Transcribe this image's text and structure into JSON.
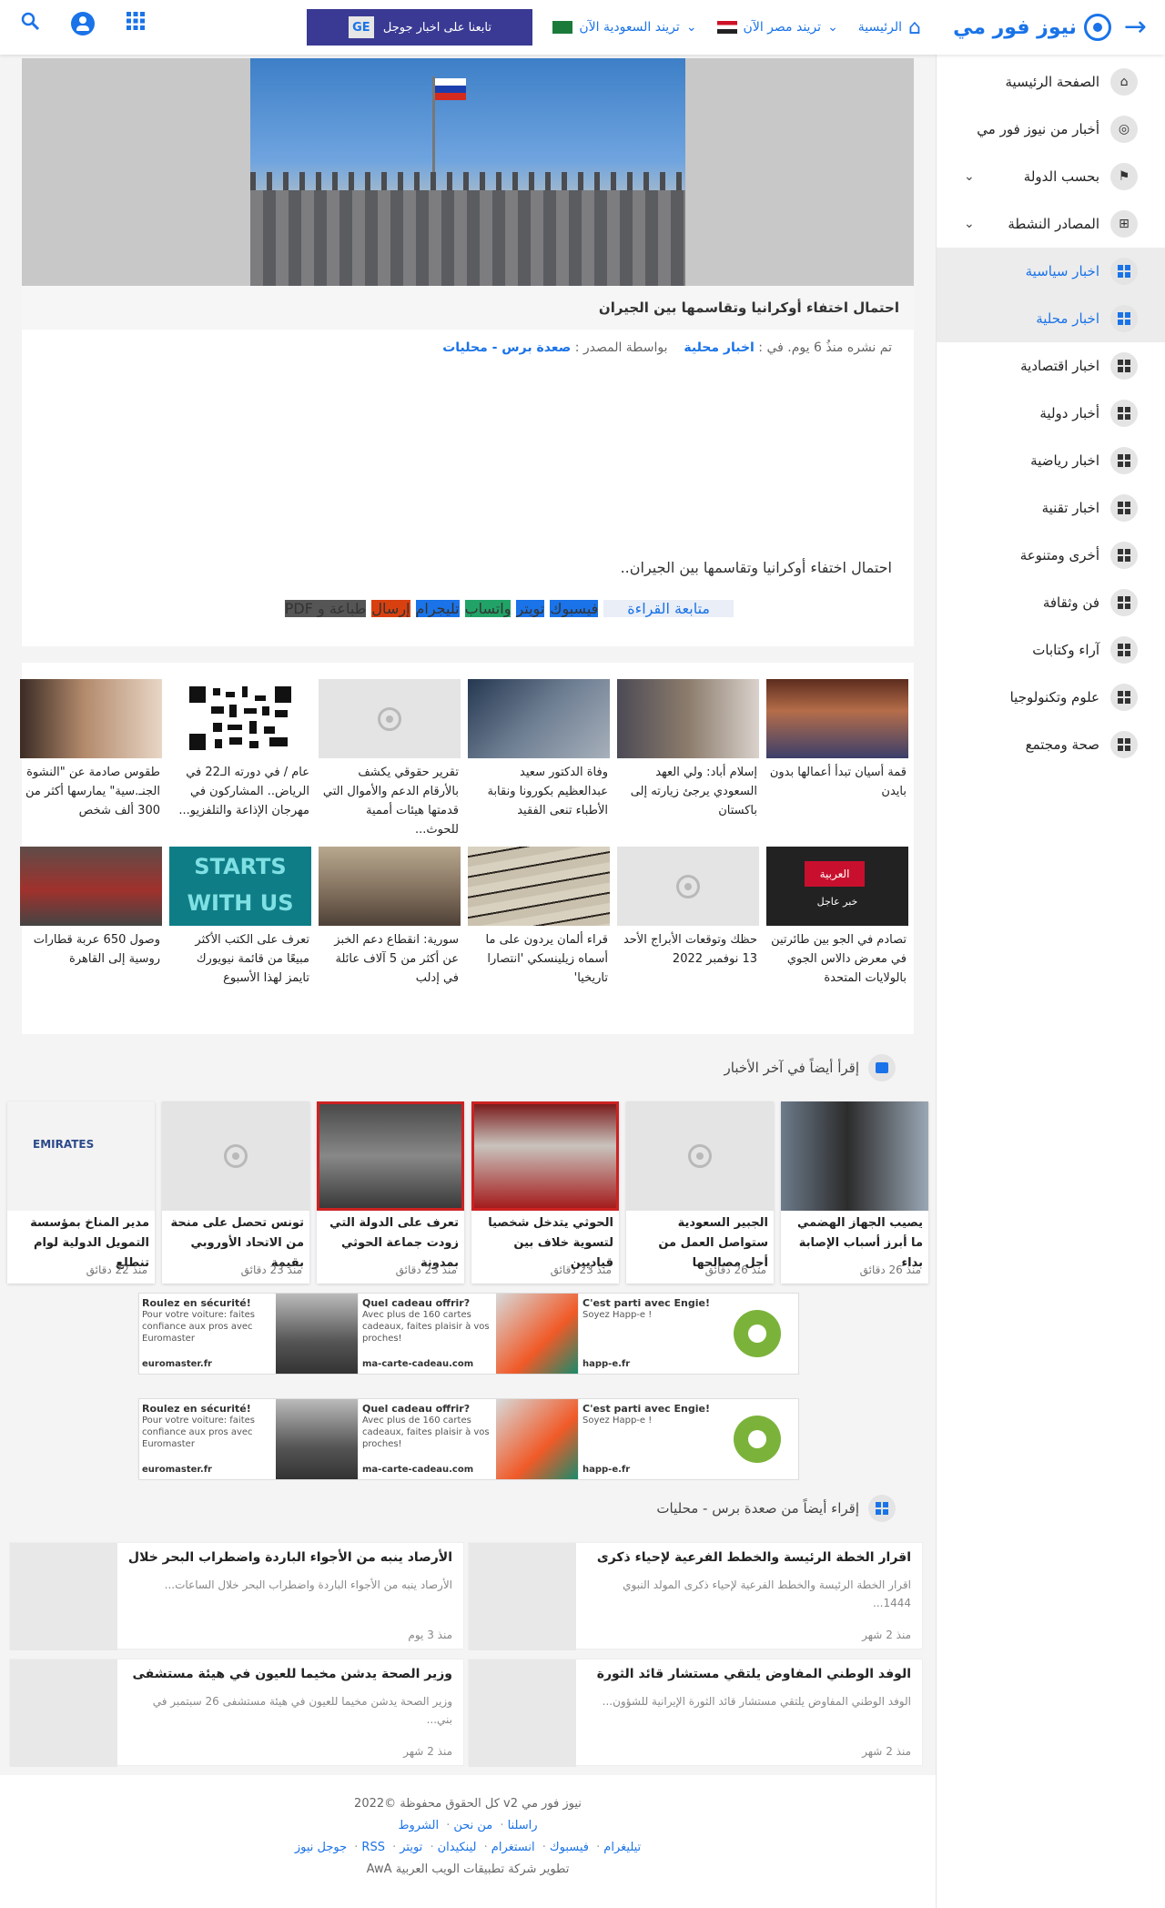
{
  "brand": {
    "name": "نيوز فور مي"
  },
  "topnav": {
    "home": "الرئيسية",
    "trend_eg": "تريند مصر الآن",
    "trend_sa": "تريند السعودية الآن",
    "gnews_label": "تابعنا على اخبار جوجل",
    "gnews_icon": "GE"
  },
  "sidebar": {
    "items": [
      {
        "label": "الصفحة الرئيسية"
      },
      {
        "label": "أخبار من نيوز فور مي"
      },
      {
        "label": "بحسب الدولة"
      },
      {
        "label": "المصادر النشطة"
      },
      {
        "label": "اخبار سياسية"
      },
      {
        "label": "اخبار محلية"
      },
      {
        "label": "اخبار اقتصادية"
      },
      {
        "label": "أخبار دولية"
      },
      {
        "label": "اخبار رياضية"
      },
      {
        "label": "اخبار تقنية"
      },
      {
        "label": "أخرى ومتنوعة"
      },
      {
        "label": "فن وثقافة"
      },
      {
        "label": "آراء وكتابات"
      },
      {
        "label": "علوم وتكنولوجيا"
      },
      {
        "label": "صحة ومجتمع"
      }
    ]
  },
  "article": {
    "title": "احتمال اختفاء أوكرانيا وتقاسمها بين الجيران",
    "meta_prefix": "تم نشره منذُ 6 يوم. في :",
    "category": "اخبار محلية",
    "source_prefix": "بواسطة المصدر :",
    "source": "صعدة برس - محليات",
    "body": "احتمال اختفاء أوكرانيا وتقاسمها بين الجيران..",
    "share": {
      "follow": "متابعة القراءة",
      "facebook": "فيسبوك",
      "twitter": "تويتر",
      "whatsapp": "واتساب",
      "telegram": "تليجرام",
      "send": "إرسال",
      "print": "طباعة و PDF"
    }
  },
  "related": [
    {
      "caption": "قمة أسيان تبدأ أعمالها بدون بايدن"
    },
    {
      "caption": "إسلام أباد: ولي العهد السعودي يرجئ زيارته إلى باكستان"
    },
    {
      "caption": "وفاة الدكتور سعيد عبدالعظيم بكورونا ونقابة الأطباء تنعى الفقيد"
    },
    {
      "caption": "تقرير حقوقي يكشف بالأرقام الدعم والأموال التي قدمتها هيئات أممية للحوث..."
    },
    {
      "caption": "عام / في دورته الـ22 في الرياض.. المشاركون في مهرجان الإذاعة والتلفزيو..."
    },
    {
      "caption": "طقوس صادمة عن \"النشوة الجنـ.سية\" يمارسها أكثر من 300 ألف شخص"
    },
    {
      "caption": "تصادم في الجو بين طائرتين في معرض دالاس الجوي بالولايات المتحدة",
      "badge": "خبر عاجل",
      "logo": "العربية"
    },
    {
      "caption": "حظك وتوقعات الأبراج الأحد 13 نوفمبر 2022"
    },
    {
      "caption": "قراء ألمان يردون على ما أسماه زيلينسكي 'انتصارا تاريخيا'"
    },
    {
      "caption": "سورية: انقطاع دعم الخبز عن أكثر من 5 آلاف عائلة في إدلب"
    },
    {
      "caption": "تعرف على الكتب الأكثر مبيعًا من قائمة نيويورك تايمز لهذا الأسبوع",
      "overlay": "STARTS WITH US"
    },
    {
      "caption": "وصول 650 عربة قطارات روسية إلى القاهرة"
    }
  ],
  "latest_heading": "إقرأ أيضاً في آخر الأخبار",
  "latest": [
    {
      "caption": "مدير المناخ بمؤسسة التمويل الدولية لوام تنطلع",
      "time": "منذ 22 دقائق",
      "logo": "EMIRATES"
    },
    {
      "caption": "تونس تحصل على منحة من الاتحاد الأوروبي بقيمة",
      "time": "منذ 23 دقائق"
    },
    {
      "caption": "تعرف على الدولة التي زودت جماعة الحوثي بمدونة",
      "time": "منذ 23 دقائق"
    },
    {
      "caption": "الحوثي يتدخل شخصيا لتسوية خلاف بين قياديين",
      "time": "منذ 23 دقائق"
    },
    {
      "caption": "الجبير السعودية ستواصل العمل من أجل مصالحها",
      "time": "منذ 26 دقائق"
    },
    {
      "caption": "يصيب الجهاز الهضمي ما أبرز أسباب الإصابة بداء",
      "time": "منذ 26 دقائق"
    }
  ],
  "ads": [
    {
      "title": "Roulez en sécurité!",
      "desc": "Pour votre voiture: faites confiance aux pros avec Euromaster",
      "domain": "euromaster.fr"
    },
    {
      "title": "Quel cadeau offrir?",
      "desc": "Avec plus de 160 cartes cadeaux, faites plaisir à vos proches!",
      "domain": "ma-carte-cadeau.com"
    },
    {
      "title": "C'est parti avec Engie!",
      "desc": "Soyez Happ-e !",
      "domain": "happ-e.fr"
    }
  ],
  "source_heading": "إقراء أيضاً من صعدة برس - محليات",
  "source_list": [
    {
      "title": "اقرار الخطة الرئيسة والخطط الفرعية لإحياء ذكرى",
      "desc": "اقرار الخطة الرئيسة والخطط الفرعية لإحياء ذكرى المولد النبوي 1444...",
      "time": "منذ 2 شهر"
    },
    {
      "title": "الأرصاد ينبه من الأجواء الباردة واضطراب البحر خلال",
      "desc": "الأرصاد ينبه من الأجواء الباردة واضطراب البحر خلال الساعات...",
      "time": "منذ 3 يوم"
    },
    {
      "title": "الوفد الوطني المفاوض يلتقي مستشار قائد الثورة",
      "desc": "الوفد الوطني المفاوض يلتقي مستشار قائد الثورة الإيرانية للشؤون...",
      "time": "منذ 2 شهر"
    },
    {
      "title": "وزير الصحة يدشن مخيما للعيون في هيئة مستشفى",
      "desc": "وزير الصحة يدشن مخيما للعيون في هيئة مستشفى 26 سبتمبر في بني...",
      "time": "منذ 2 شهر"
    }
  ],
  "footer": {
    "copyright": "نيوز فور مي v2 كل الحقوق محفوظة ©2022",
    "links1": [
      "راسلنا",
      "من نحن",
      "الشروط"
    ],
    "links2": [
      "تيليغرام",
      "فيسبوك",
      "انستغرام",
      "لينكيدان",
      "تويتر",
      "RSS",
      "جوجل نيوز"
    ],
    "credit": "تطوير شركة تطبيقات الويب العربية AwA"
  }
}
